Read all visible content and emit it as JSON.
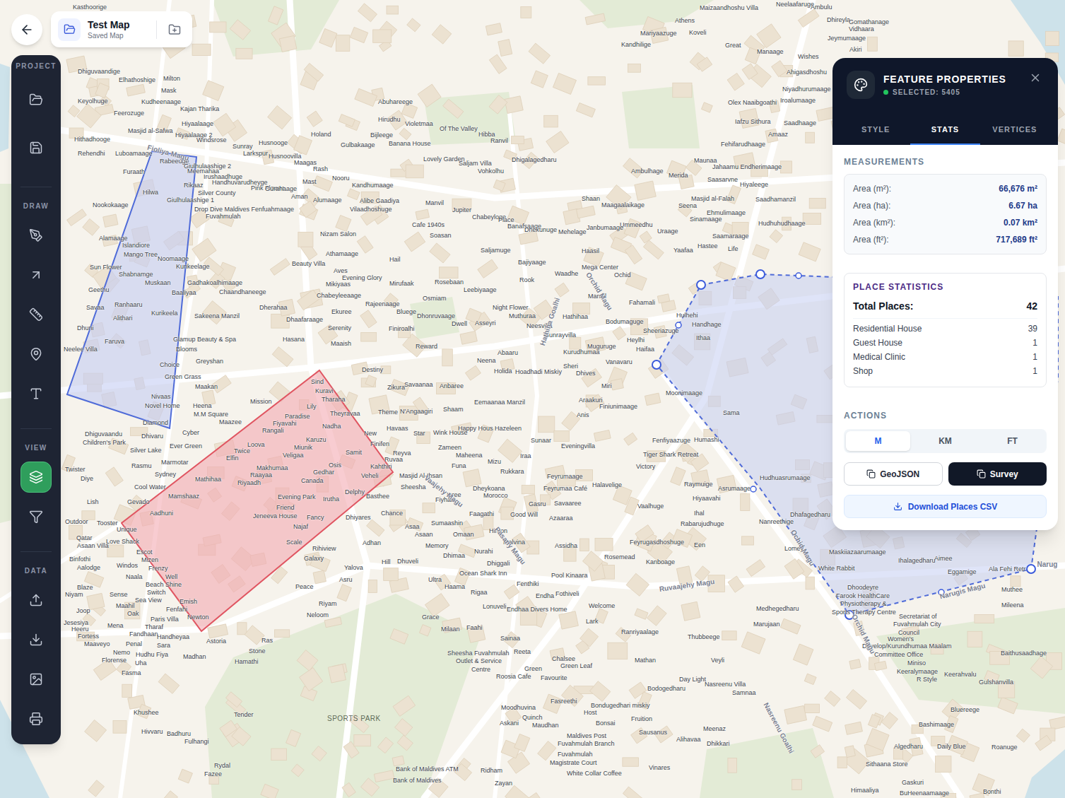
{
  "titleCard": {
    "title": "Test Map",
    "subtitle": "Saved Map"
  },
  "toolbar": {
    "sections": [
      {
        "label": "PROJECT",
        "items": [
          {
            "kind": "open",
            "selected": false
          },
          {
            "kind": "save",
            "selected": false
          }
        ]
      },
      {
        "label": "DRAW",
        "items": [
          {
            "kind": "draw",
            "selected": false
          },
          {
            "kind": "arrow",
            "selected": false
          },
          {
            "kind": "measure",
            "selected": false
          },
          {
            "kind": "pin",
            "selected": false
          },
          {
            "kind": "text",
            "selected": false
          }
        ]
      },
      {
        "label": "VIEW",
        "items": [
          {
            "kind": "layers",
            "selected": true
          },
          {
            "kind": "filter",
            "selected": false
          }
        ]
      },
      {
        "label": "DATA",
        "items": [
          {
            "kind": "upload",
            "selected": false
          },
          {
            "kind": "download",
            "selected": false
          },
          {
            "kind": "image",
            "selected": false
          },
          {
            "kind": "print",
            "selected": false
          }
        ]
      }
    ]
  },
  "panel": {
    "title": "FEATURE PROPERTIES",
    "status": "SELECTED: 5405",
    "tabs": [
      {
        "label": "STYLE",
        "selected": false
      },
      {
        "label": "STATS",
        "selected": true
      },
      {
        "label": "VERTICES",
        "selected": false
      }
    ],
    "measurements": {
      "label": "MEASUREMENTS",
      "rows": [
        {
          "label": "Area (m²):",
          "value": "66,676 m²"
        },
        {
          "label": "Area (ha):",
          "value": "6.67 ha"
        },
        {
          "label": "Area (km²):",
          "value": "0.07 km²"
        },
        {
          "label": "Area (ft²):",
          "value": "717,689 ft²"
        }
      ]
    },
    "places": {
      "label": "PLACE STATISTICS",
      "totalLabel": "Total Places:",
      "total": "42",
      "rows": [
        {
          "label": "Residential House",
          "value": "39"
        },
        {
          "label": "Guest House",
          "value": "1"
        },
        {
          "label": "Medical Clinic",
          "value": "1"
        },
        {
          "label": "Shop",
          "value": "1"
        }
      ]
    },
    "actions": {
      "label": "ACTIONS",
      "units": [
        {
          "label": "M",
          "selected": true
        },
        {
          "label": "KM",
          "selected": false
        },
        {
          "label": "FT",
          "selected": false
        }
      ],
      "buttons": [
        {
          "label": "GeoJSON",
          "kind": "outline"
        },
        {
          "label": "Survey",
          "kind": "solid"
        }
      ],
      "download": "Download Places CSV"
    }
  },
  "map": {
    "park": "SPORTS PARK",
    "streets": [
      "Fioliya Magu",
      "Hathiha Goalhi",
      "Orchid Magu",
      "Vaajehy Magu",
      "Pasany Magu",
      "Ruvaajehy Magu",
      "Ochid Magu",
      "Narugis Magu",
      "Orchid Magu",
      "Nasreenu Goalhi",
      "Narug"
    ],
    "labels": [
      "Kasthoorige",
      "Maizaandhoshu Villa",
      "Neelaafaruge",
      "Ambulu",
      "Dhireyla",
      "Gomathanage",
      "Vidhaara",
      "Jeymumaage",
      "Akiri",
      "Athens",
      "Koveli",
      "Mariyaazuge",
      "Kandhilige",
      "Great",
      "Manaage",
      "Wishes",
      "Ahigasdhoshu",
      "Niyadhurumaage",
      "Iroalumaage",
      "Olex Naaibgoathi",
      "Iafzu Sithura",
      "Saadhaage",
      "Amaaz",
      "Fehifarudhaage",
      "Maunaa",
      "Jahaamu Endherimaage",
      "Ambulhage",
      "Merida",
      "Saasarvne",
      "Hiyaleege",
      "Masjid al-Falah",
      "Seena",
      "Saadhamanzil",
      "Ehmulimaage",
      "Sinamaage",
      "Hudhuhudhaage",
      "Ummeedhu",
      "Uraage",
      "Saamaraage",
      "Hastee",
      "Life",
      "Yaafaa",
      "Dhiguvaandige",
      "Elhathoshige",
      "Milton",
      "Mask",
      "Keyolhuge",
      "Kudheenaage",
      "Kajan Tharika",
      "Feerozuge",
      "Hiyaalaage",
      "Masjid al-Safwa",
      "Hiyaalaage 2",
      "Hithadhooge",
      "Windsrose",
      "Sunray",
      "Larkspur",
      "Rehendhi",
      "Luboamaage",
      "Rabeeuge",
      "Giulhulaashige 2",
      "Furaath",
      "Meemahaa",
      "Irushaadhuge",
      "Handhuvarudheyge",
      "Rikaaz",
      "Pink Flower",
      "Hilwa",
      "Silver County",
      "Giulhulaashige 1",
      "Nookokaage",
      "Drop Dive Maldives Fenfuahmaage",
      "Fuvahmulah",
      "Alamaage",
      "Islandiore",
      "Mango Tree",
      "Noomaage",
      "Sun Flower",
      "Kurikeelage",
      "Shabnamge",
      "Muskaan",
      "Gadhakoalhimaage",
      "Geethu",
      "Chaandhaneege",
      "Baaliyaa",
      "Ranhaaru",
      "Savaa",
      "Kurikeela",
      "Sakeena Manzil",
      "Alithari",
      "Dhuni",
      "Faruva",
      "Glamup Beauty & Spa",
      "Neelee Villa",
      "Blooms",
      "Greyshan",
      "Choice",
      "Green Grass",
      "Maakan",
      "Nivaas",
      "Novel Home",
      "Heena",
      "M.M Square",
      "Diamond",
      "Maazee",
      "Mission",
      "Abuhareege",
      "Hirudhu",
      "Violetmaa",
      "Of The Valley",
      "Holand",
      "Bijleege",
      "Hibba",
      "Ranvil",
      "Husnooge",
      "Banana House",
      "Gulbakaage",
      "Husnoovilla",
      "Lovely Garden",
      "Dhigalagedharu",
      "Maagas",
      "Saljam Villa",
      "Rash",
      "Vohkolhu",
      "Nooru",
      "Mast",
      "Kandhumaage",
      "Gurahaage",
      "Aman",
      "Alumaage",
      "Alibe Gaadiya",
      "Shaan",
      "Manvil",
      "Maagaalaikage",
      "Vilaadhoshuge",
      "Jupiter",
      "Chabeyloge",
      "Place",
      "Cafe 1940s",
      "Banafsaage",
      "Janbumaage",
      "Dhekunuge",
      "Mehelage",
      "Soasan",
      "Nizam Salon",
      "Saljamuge",
      "Haasil",
      "Athamaage",
      "Hail",
      "Bajiyaage",
      "Beauty Villa",
      "Mega Center",
      "Aves",
      "Waadhe",
      "Ochid",
      "Evening Glory",
      "Rook",
      "Rosebaan",
      "Mirufaak",
      "Mikiyaas",
      "Leebiyaage",
      "Chabeyleeaage",
      "Manzil",
      "Osmiam",
      "Fahamali",
      "Rajeenaage",
      "Dherahaa",
      "Night Flower",
      "Ekuree",
      "Bluege",
      "Hulhehi",
      "Muthuraa",
      "Dhonruvaage",
      "Hathihaa",
      "Dhaafaraage",
      "Bodumaguge",
      "Dwell",
      "Asseyri",
      "Handhage",
      "Neesvilla",
      "Serenity",
      "Finiroalhi",
      "Sheeriazuge",
      "Sunrayvilla",
      "Ithaa",
      "Hasana",
      "Heylhi",
      "Maaish",
      "Reward",
      "Muguruge",
      "Haifaa",
      "Kurudhumaa",
      "Abaaru",
      "Neena",
      "Vanavaru",
      "Sheri",
      "Destiny",
      "Holida",
      "Hoadhadi Miskiy",
      "Dhives",
      "Savaanaa",
      "Anbaree",
      "Miri",
      "Zikura",
      "Moonimaage",
      "Araakuri",
      "Eemaanaa Manzil",
      "Finiunimaage",
      "Shaam",
      "N'Angaagiri",
      "Theme",
      "Sama",
      "Anis",
      "Havaas",
      "Happy Hous Hazeleen",
      "Wink House",
      "Star",
      "Humashi",
      "Sunaar",
      "Fenfiyaazuge",
      "Eveningvilla",
      "Zameen",
      "Tiger Shark Retreat",
      "Maheena",
      "Iraa",
      "Mizu",
      "Funa",
      "Victory",
      "Rukkara",
      "Masjid Al-Ihsan",
      "Feyrumaage",
      "Hudhuasrumaage",
      "Raymuige",
      "Halavelige",
      "Sheesha",
      "Feyrumaa Café",
      "Dheykoana",
      "Asrumaage",
      "Morocco",
      "Iaree",
      "Hiyaavahi",
      "Fiyhaa",
      "Savaaree",
      "Gasru",
      "Vaalhuge",
      "Ihal",
      "Faagathi",
      "Good Will",
      "Dhafagedharu",
      "Azaaraa",
      "Nanreethige",
      "Sumaashin",
      "Rabarujudhuge",
      "Asaa",
      "Hinton",
      "Asaan",
      "Omaan",
      "Malvina",
      "Feyrugasdhoshuge",
      "Een",
      "Assidha",
      "Memory",
      "Lomey",
      "Nurahi",
      "Maskiiazaarumaage",
      "Dhimaa",
      "Rosemead",
      "Aimee",
      "Ihalagedharu",
      "Kanboage",
      "Dhiggali",
      "White Rabbit",
      "Ala Fehi Retr",
      "Eggamige",
      "Ocean Shark Inn",
      "Pool Kinaara",
      "Ultra",
      "Fenthiki",
      "Haama",
      "Dhoodeyre",
      "Muthee",
      "Rigaa",
      "Fothiveli",
      "Endha",
      "Farook HealthCare",
      "Physiotherapy &",
      "Mileena",
      "Welcome",
      "Lonuveli",
      "Medhegedharu",
      "Endhaa Divers Home",
      "Sports Therapy Centre",
      "Secretariat of",
      "Grace",
      "Lark",
      "Marujaan",
      "Fuvahmulah City",
      "Faahi",
      "Milaan",
      "Ranriyaalage",
      "Council",
      "Thubbeege",
      "Sainaa",
      "Women's",
      "Develop/Kurundhumaa Maalam",
      "Reeta",
      "Sheesha Fuvahmulah",
      "Baithusaadhage",
      "Committee Office",
      "Chalsee",
      "Mathan",
      "Veyli",
      "Outlet & Service",
      "Green Leaf",
      "Miniso",
      "Green",
      "Centre",
      "Keeralymaage",
      "Keerahvalu",
      "Roosia Cafe",
      "Favourite",
      "Day Light",
      "R Style",
      "Gulshanvilla",
      "Nasreenu Villa",
      "Bodogedharu",
      "Samnaa",
      "Fasreethi",
      "Bondugedhari miskiy",
      "Moodhuvina",
      "Bluereege",
      "Host",
      "Khushee",
      "Tender",
      "Quinch",
      "Fruition",
      "Askani",
      "Bonsai",
      "Bashimaage",
      "Maudhan",
      "Meenaz",
      "Hivvaru",
      "Sausanus",
      "Badhuru",
      "Maldives Post",
      "Alihavaa",
      "Fulhangi",
      "Fuvahmulah Branch",
      "Dhikkari",
      "Algedharu",
      "Daily Blue",
      "Roanuge",
      "Fuvahmulah",
      "Magistrate Court",
      "Sithaana Store",
      "Rydal",
      "Vinares",
      "Bank of Maldives ATM",
      "Ridham",
      "White Collar Coffee",
      "Fazee",
      "Bank of Maldives",
      "Gaskuri",
      "Zayan",
      "Himaaliya",
      "BuHeenaamaage",
      "Bonthi",
      "Sind",
      "Kuravi",
      "Tharaha",
      "Lily",
      "Theyravaa",
      "Paradise",
      "Fiyavahi",
      "Nadha",
      "Rangali",
      "New",
      "Karuzu",
      "Finifen",
      "Loova",
      "Miunik",
      "Twice",
      "Samit",
      "Reyva",
      "Veligaa",
      "Elfin",
      "Ruvaa",
      "Osis",
      "Kahthiri",
      "Makhumaa",
      "Gedhar",
      "Raayaa",
      "Veheli",
      "Mathihaa",
      "Canada",
      "Riyaadh",
      "Delphy",
      "Basthee",
      "Mamshaaz",
      "Evening Park",
      "Irutha",
      "Friend",
      "Aadhuni",
      "Chance",
      "Jeneeva House",
      "Fancy",
      "Dhiyares",
      "Najaf",
      "Scale",
      "Adhan",
      "Rihiview",
      "Galaxy",
      "Hill",
      "Dhuveli",
      "Yalova",
      "Asru",
      "Peace",
      "Riyam",
      "Neloom",
      "Dhivaru",
      "Cyber",
      "Dhiguvaandu",
      "Children's Park",
      "Ever Green",
      "Silver Lake",
      "Marmotar",
      "Rasmu",
      "Twister",
      "Sydney",
      "Diye",
      "Cool Water",
      "Gevado",
      "Lish",
      "Outdoor",
      "Tooster",
      "Unique",
      "Qatar",
      "Love Shack",
      "Asaan Villa",
      "Escot",
      "Binfothi",
      "Mizen",
      "Windos",
      "Aalodge",
      "Frenzy",
      "Naala",
      "Well",
      "Beach Shine",
      "Blaze",
      "Switch",
      "Sense",
      "Niyam",
      "Sea View",
      "Emish",
      "Maahil",
      "Fenfahi",
      "Joop",
      "Oak",
      "Newton",
      "Paris Villa",
      "Jesesiya",
      "Mena",
      "Tharaf",
      "Heeru",
      "Fandhaan",
      "Fortess",
      "Handheyaa",
      "Astoria",
      "Ras",
      "Penal",
      "Maaveyo",
      "Sara",
      "Stone",
      "Nemo",
      "Hudhu Fiya",
      "Madhan",
      "Florense",
      "Hamathi",
      "Uha",
      "Fasma"
    ]
  }
}
